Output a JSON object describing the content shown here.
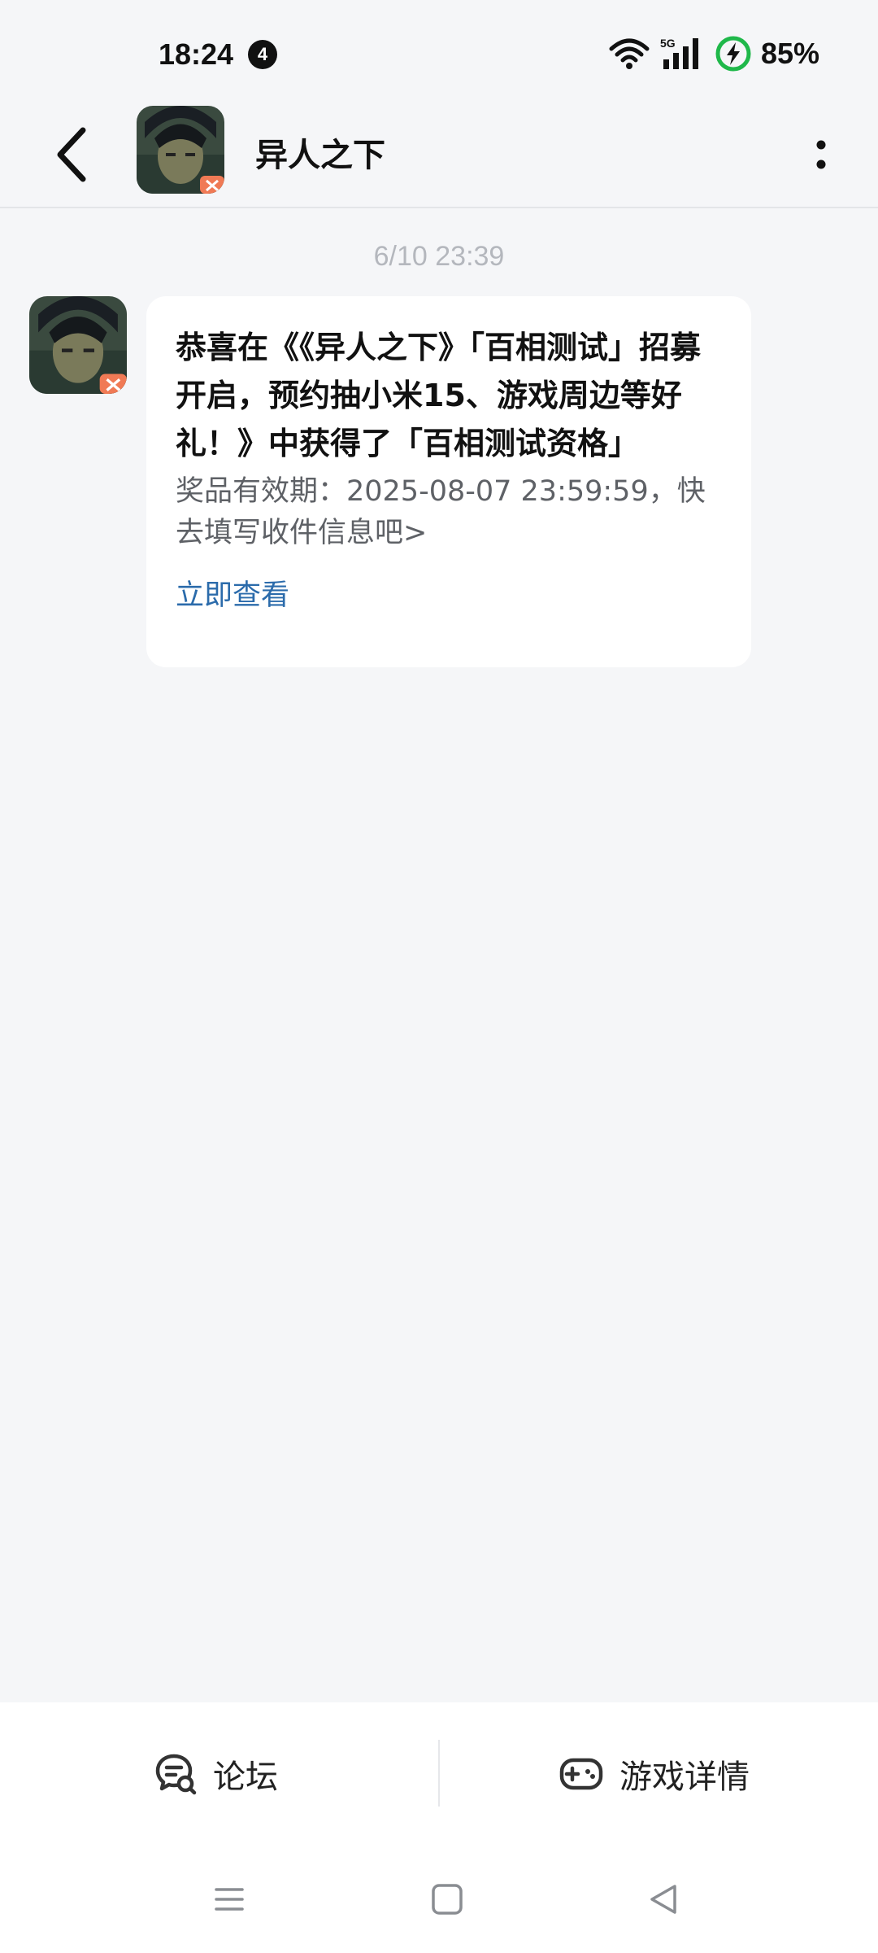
{
  "status_bar": {
    "time": "18:24",
    "notification_count": "4",
    "network": "5G",
    "battery": "85%"
  },
  "header": {
    "title": "异人之下"
  },
  "chat": {
    "timestamp": "6/10  23:39",
    "message": {
      "title": "恭喜在《《异人之下》「百相测试」招募开启，预约抽小米15、游戏周边等好礼！》中获得了「百相测试资格」",
      "body": "奖品有效期：2025-08-07 23:59:59，快去填写收件信息吧>",
      "link": "立即查看"
    }
  },
  "bottom_bar": {
    "forum_label": "论坛",
    "details_label": "游戏详情"
  },
  "colors": {
    "background": "#f5f6f8",
    "link": "#2b6bab",
    "battery_green": "#1fb84a"
  },
  "icons": [
    "back-icon",
    "more-icon",
    "forum-icon",
    "gamepad-icon",
    "menu-icon",
    "home-icon",
    "nav-back-icon",
    "wifi-icon",
    "signal-icon",
    "battery-icon"
  ]
}
